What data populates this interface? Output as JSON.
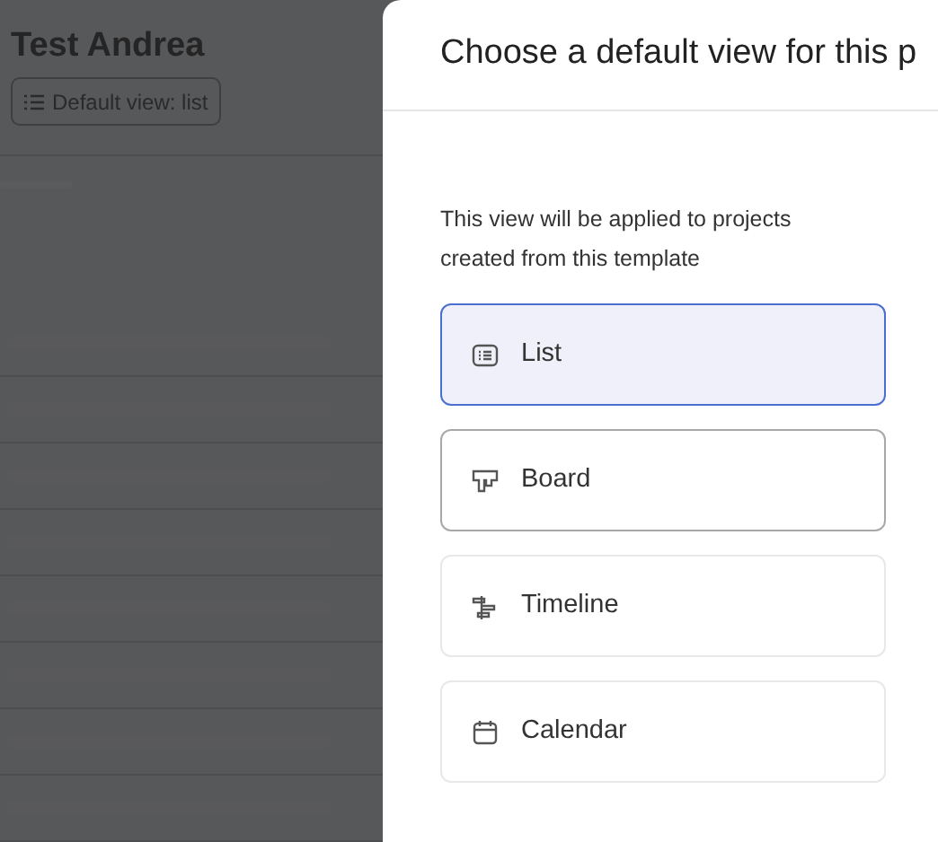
{
  "background_page": {
    "title": "Test Andrea",
    "default_view_button": "Default view: list"
  },
  "dialog": {
    "title": "Choose a default view for this p",
    "description": "This view will be applied to projects created from this template",
    "options": [
      {
        "kind": "list",
        "label": "List",
        "selected": true,
        "hovered": false
      },
      {
        "kind": "board",
        "label": "Board",
        "selected": false,
        "hovered": true
      },
      {
        "kind": "timeline",
        "label": "Timeline",
        "selected": false,
        "hovered": false
      },
      {
        "kind": "calendar",
        "label": "Calendar",
        "selected": false,
        "hovered": false
      }
    ]
  }
}
